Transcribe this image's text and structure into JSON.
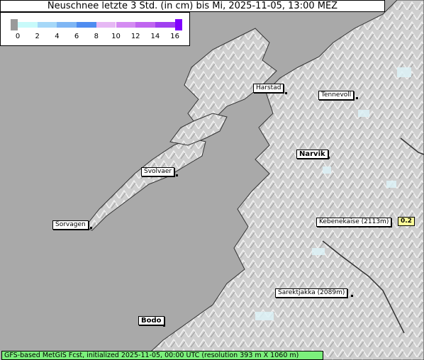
{
  "title": "Neuschnee letzte 3 Std. (in cm) bis Mi, 2025-11-05, 13:00 MEZ",
  "legend": {
    "ticks": [
      "0",
      "2",
      "4",
      "6",
      "8",
      "10",
      "12",
      "14",
      "16"
    ],
    "colors": [
      "#c8fafa",
      "#a6d8f8",
      "#7fb6f4",
      "#4f8cf0",
      "#e6b8f4",
      "#d48cf2",
      "#c066f0",
      "#a040f0"
    ],
    "under_color": "#9a9a9a",
    "over_color": "#8000ff"
  },
  "places": [
    {
      "name": "Harstad",
      "bold": false
    },
    {
      "name": "Tennevoll",
      "bold": false
    },
    {
      "name": "Narvik",
      "bold": true
    },
    {
      "name": "Svolvaer",
      "bold": false
    },
    {
      "name": "Kebenekaise (2113m)",
      "bold": false
    },
    {
      "name": "Sorvagen",
      "bold": false
    },
    {
      "name": "Sarektjakka (2089m)",
      "bold": false
    },
    {
      "name": "Bodo",
      "bold": true
    }
  ],
  "values": [
    {
      "place": "Kebenekaise (2113m)",
      "value": "0.2"
    }
  ],
  "footer": "GFS-based MetGIS Fcst, initialized 2025-11-05, 00:00 UTC  (resolution 393 m X 1060 m)"
}
